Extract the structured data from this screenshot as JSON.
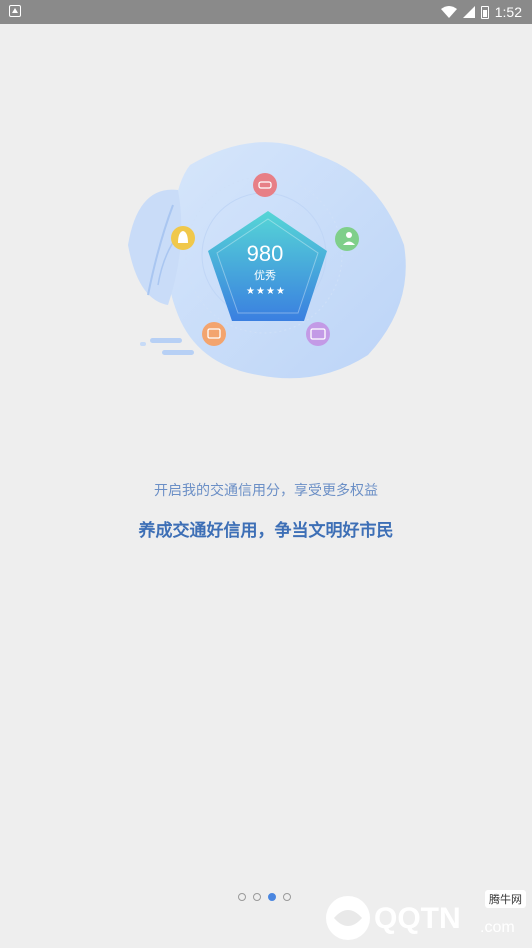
{
  "status_bar": {
    "time": "1:52",
    "icons": [
      "notification-icon",
      "wifi-icon",
      "signal-icon",
      "battery-icon"
    ]
  },
  "illustration": {
    "score": "980",
    "grade": "优秀",
    "stars": 4,
    "icons": [
      "car-icon",
      "user-settings-icon",
      "id-card-icon",
      "flag-card-icon",
      "bell-icon"
    ]
  },
  "onboarding": {
    "subtitle": "开启我的交通信用分，享受更多权益",
    "title": "养成交通好信用，争当文明好市民"
  },
  "pager": {
    "total": 4,
    "active_index": 2
  },
  "watermark": {
    "brand": "QQTN",
    "suffix": ".com",
    "badge": "腾牛网"
  },
  "colors": {
    "background": "#eeeeee",
    "title": "#3d6fb6",
    "subtitle": "#6b8fc6",
    "accent": "#4a86e0"
  }
}
